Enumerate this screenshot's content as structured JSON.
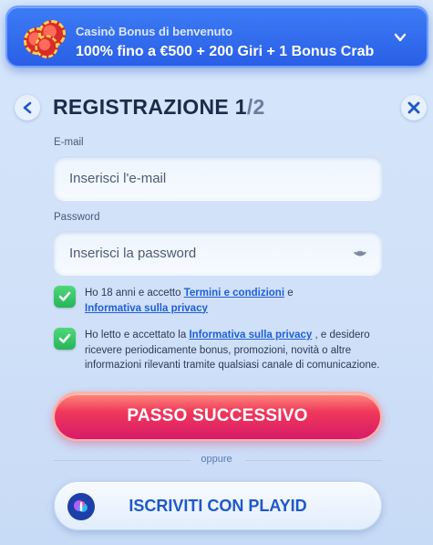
{
  "bonus": {
    "title": "Casinò Bonus di benvenuto",
    "offer": "100% fino a €500 + 200 Giri + 1 Bonus Crab"
  },
  "header": {
    "title": "REGISTRAZIONE 1",
    "step_suffix": "/2"
  },
  "form": {
    "email_label": "E-mail",
    "email_placeholder": "Inserisci l'e-mail",
    "email_value": "",
    "password_label": "Password",
    "password_placeholder": "Inserisci la password",
    "password_value": ""
  },
  "consents": [
    {
      "checked": true,
      "text_before": "Ho 18 anni e accetto ",
      "link1": "Termini e condizioni",
      "text_middle": " e ",
      "link2": "Informativa sulla privacy",
      "text_after": ""
    },
    {
      "checked": true,
      "text_before": "Ho letto e accettato la ",
      "link1": "Informativa sulla privacy",
      "text_after": " , e desidero ricevere periodicamente bonus, promozioni, novità o altre informazioni rilevanti tramite qualsiasi canale di comunicazione."
    }
  ],
  "actions": {
    "next_label": "PASSO SUCCESSIVO",
    "divider_text": "oppure",
    "playid_label": "ISCRIVITI CON PLAYID"
  },
  "colors": {
    "banner": "#2a5fe6",
    "primary": "#f0395a",
    "checkbox": "#26b55a",
    "link": "#1f5fd6"
  },
  "icons": {
    "banner": "casino-chips-icon",
    "expand": "chevron-down-icon",
    "back": "chevron-left-icon",
    "close": "close-icon",
    "password_toggle": "eye-icon",
    "check": "checkmark-icon",
    "playid": "playid-logo-icon"
  }
}
